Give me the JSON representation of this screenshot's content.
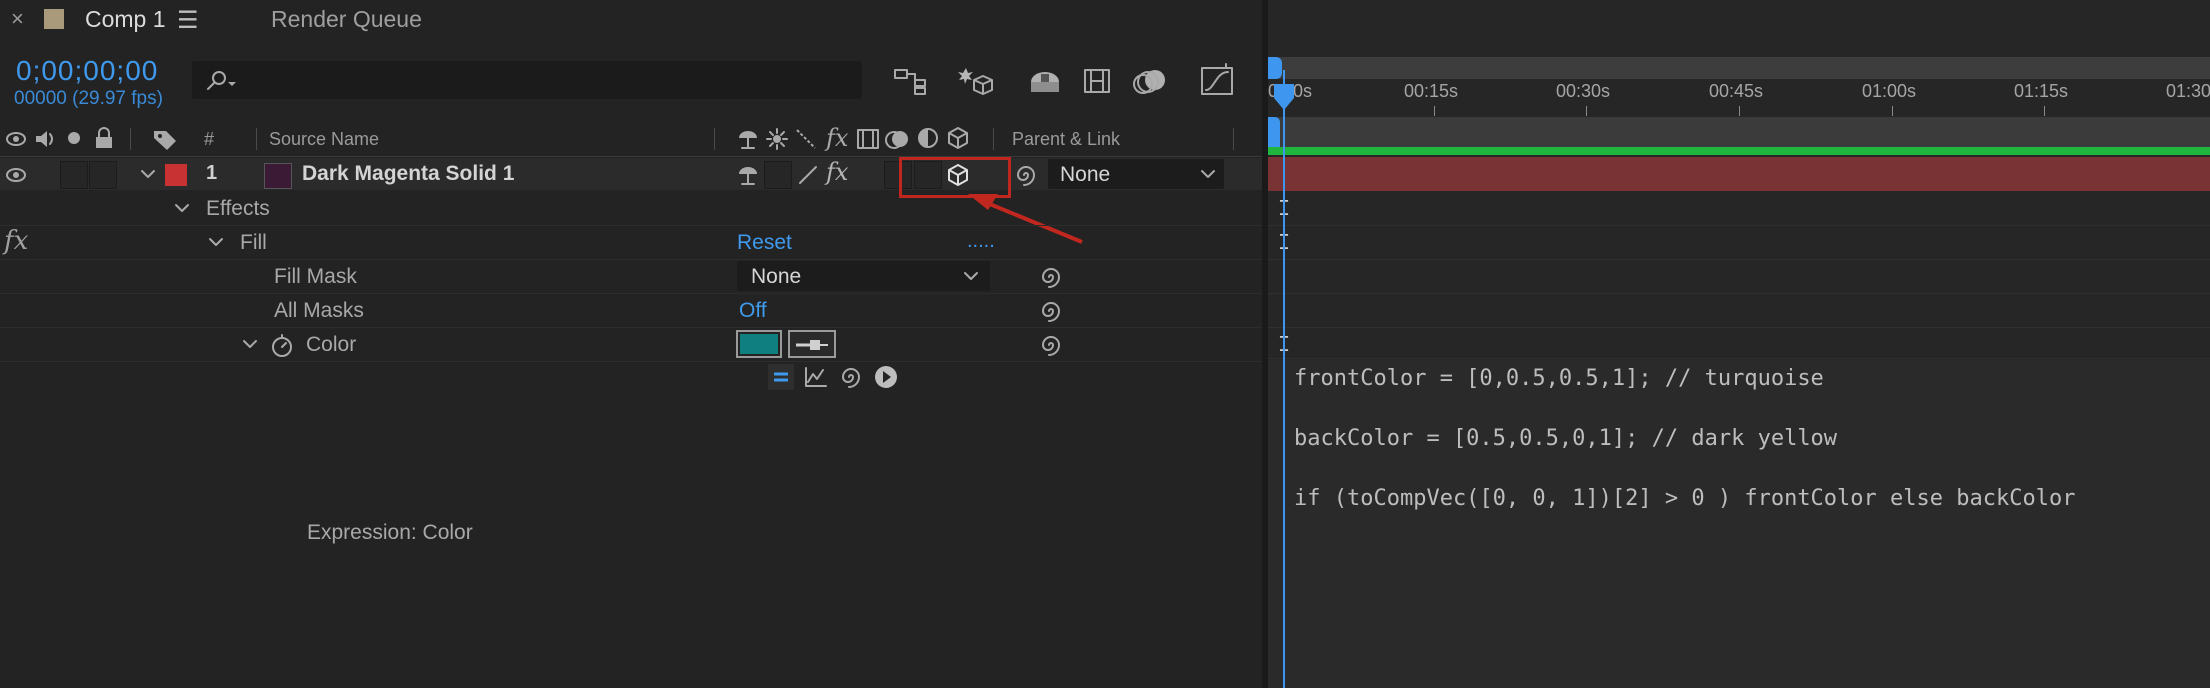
{
  "tabs": {
    "close_glyph": "×",
    "comp_label": "Comp 1",
    "menu_glyph": "☰",
    "render_queue_label": "Render Queue",
    "comp_swatch_color": "#a89a7b"
  },
  "header": {
    "timecode": "0;00;00;00",
    "frame_info": "00000 (29.97 fps)",
    "search_placeholder": ""
  },
  "columns": {
    "number": "#",
    "source_name": "Source Name",
    "parent_link": "Parent & Link"
  },
  "layer": {
    "index": "1",
    "name": "Dark Magenta Solid 1",
    "label_color": "#c83232",
    "solid_color": "#3a1a35",
    "parent_value": "None"
  },
  "properties": {
    "effects_label": "Effects",
    "fill_label": "Fill",
    "reset_label": "Reset",
    "reset_more": ".....",
    "fill_mask_label": "Fill Mask",
    "fill_mask_value": "None",
    "all_masks_label": "All Masks",
    "all_masks_value": "Off",
    "color_label": "Color",
    "color_value": "#0f7f80",
    "expression_label": "Expression: Color"
  },
  "timeline": {
    "ticks": [
      "0:00s",
      "00:15s",
      "00:30s",
      "00:45s",
      "01:00s",
      "01:15s",
      "01:30"
    ],
    "expression_lines": [
      "frontColor = [0,0.5,0.5,1]; // turquoise",
      "backColor = [0.5,0.5,0,1]; // dark yellow",
      "if (toCompVec([0, 0, 1])[2] > 0 ) frontColor else backColor"
    ]
  },
  "annotation": {
    "highlight_color": "#c0271f"
  }
}
